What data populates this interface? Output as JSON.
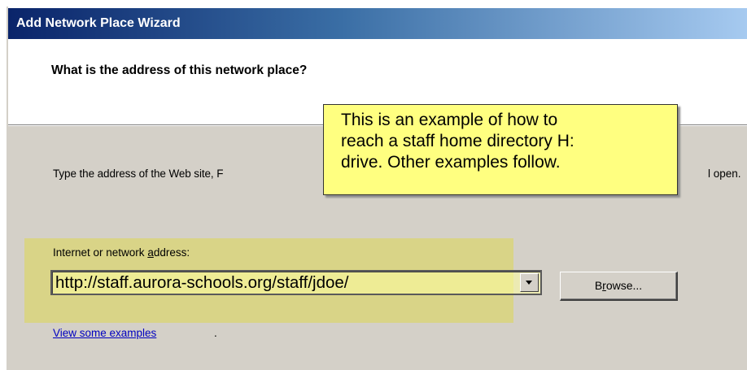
{
  "window": {
    "title": "Add Network Place Wizard"
  },
  "header": {
    "title": "What is the address of this network place?"
  },
  "body": {
    "instructions_start": "Type the address of the Web site, F",
    "instructions_end": "l open."
  },
  "callout": {
    "lines": [
      "This is an example of how to",
      "reach a staff home directory H:",
      "drive.  Other examples follow."
    ]
  },
  "address": {
    "label_before": "Internet or network ",
    "label_accel": "a",
    "label_after": "ddress:",
    "value": "http://staff.aurora-schools.org/staff/jdoe/",
    "dropdown_icon": "chevron-down-icon"
  },
  "browse_button": {
    "label_before": "B",
    "label_accel": "r",
    "label_after": "owse..."
  },
  "examples_link": {
    "label": "View some examples",
    "suffix": "."
  },
  "colors": {
    "title_gradient_start": "#0a246a",
    "title_gradient_end": "#a6caf0",
    "dialog_face": "#d4d0c8",
    "callout_fill": "#ffff80",
    "highlight_fill": "#dcd75f",
    "link": "#0000c0"
  }
}
